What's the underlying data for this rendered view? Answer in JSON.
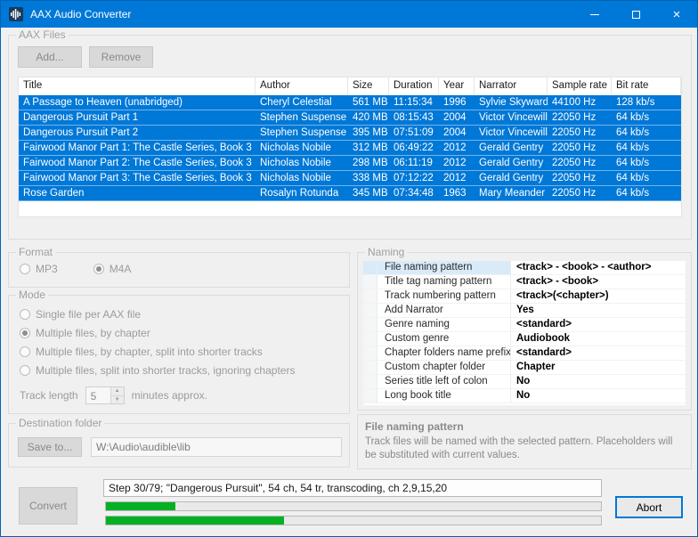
{
  "window": {
    "title": "AAX Audio Converter"
  },
  "aax_files": {
    "label": "AAX Files",
    "add_button": "Add...",
    "remove_button": "Remove",
    "table": {
      "columns": [
        "Title",
        "Author",
        "Size",
        "Duration",
        "Year",
        "Narrator",
        "Sample rate",
        "Bit rate"
      ],
      "rows": [
        [
          "A Passage to Heaven (unabridged)",
          "Cheryl Celestial",
          "561 MB",
          "11:15:34",
          "1996",
          "Sylvie Skyward",
          "44100 Hz",
          "128 kb/s"
        ],
        [
          "Dangerous Pursuit Part 1",
          "Stephen Suspense",
          "420 MB",
          "08:15:43",
          "2004",
          "Victor Vincewill",
          "22050 Hz",
          "64 kb/s"
        ],
        [
          "Dangerous Pursuit Part 2",
          "Stephen Suspense",
          "395 MB",
          "07:51:09",
          "2004",
          "Victor Vincewill",
          "22050 Hz",
          "64 kb/s"
        ],
        [
          "Fairwood Manor Part 1: The Castle Series, Book 3",
          "Nicholas Nobile",
          "312 MB",
          "06:49:22",
          "2012",
          "Gerald Gentry",
          "22050 Hz",
          "64 kb/s"
        ],
        [
          "Fairwood Manor Part 2: The Castle Series, Book 3",
          "Nicholas Nobile",
          "298 MB",
          "06:11:19",
          "2012",
          "Gerald Gentry",
          "22050 Hz",
          "64 kb/s"
        ],
        [
          "Fairwood Manor Part 3: The Castle Series, Book 3",
          "Nicholas Nobile",
          "338 MB",
          "07:12:22",
          "2012",
          "Gerald Gentry",
          "22050 Hz",
          "64 kb/s"
        ],
        [
          "Rose Garden",
          "Rosalyn Rotunda",
          "345 MB",
          "07:34:48",
          "1963",
          "Mary Meander",
          "22050 Hz",
          "64 kb/s"
        ]
      ]
    }
  },
  "format": {
    "label": "Format",
    "options": [
      {
        "label": "MP3",
        "selected": false
      },
      {
        "label": "M4A",
        "selected": true
      }
    ]
  },
  "mode": {
    "label": "Mode",
    "options": [
      {
        "label": "Single file per AAX file",
        "selected": false
      },
      {
        "label": "Multiple files, by chapter",
        "selected": true
      },
      {
        "label": "Multiple files, by chapter, split into shorter tracks",
        "selected": false
      },
      {
        "label": "Multiple files, split into shorter tracks, ignoring chapters",
        "selected": false
      }
    ],
    "track_length_label": "Track length",
    "track_length_value": "5",
    "track_length_suffix": "minutes approx."
  },
  "naming": {
    "label": "Naming",
    "rows": [
      {
        "name": "File naming pattern",
        "value": "<track> - <book> - <author>"
      },
      {
        "name": "Title tag naming pattern",
        "value": "<track> - <book>"
      },
      {
        "name": "Track numbering pattern",
        "value": "<track>(<chapter>)"
      },
      {
        "name": "Add Narrator",
        "value": "Yes"
      },
      {
        "name": "Genre naming",
        "value": "<standard>"
      },
      {
        "name": "Custom genre",
        "value": "Audiobook"
      },
      {
        "name": "Chapter folders name prefix",
        "value": "<standard>"
      },
      {
        "name": "Custom chapter folder",
        "value": "Chapter"
      },
      {
        "name": "Series title left of colon",
        "value": "No"
      },
      {
        "name": "Long book title",
        "value": "No"
      }
    ]
  },
  "naming_help": {
    "title": "File naming pattern",
    "text": "Track files will be named with the selected pattern. Placeholders will be substituted with current values."
  },
  "destination": {
    "label": "Destination folder",
    "save_button": "Save to...",
    "path": "W:\\Audio\\audible\\lib"
  },
  "footer": {
    "convert_button": "Convert",
    "status": "Step 30/79; \"Dangerous Pursuit\", 54 ch, 54 tr, transcoding, ch 2,9,15,20",
    "progress_primary_percent": 14,
    "progress_secondary_percent": 36,
    "abort_button": "Abort"
  },
  "colors": {
    "titlebar": "#0078d7",
    "selection": "#0078d7",
    "progress_fill": "#06b025",
    "abort_focus_border": "#0078d7"
  }
}
